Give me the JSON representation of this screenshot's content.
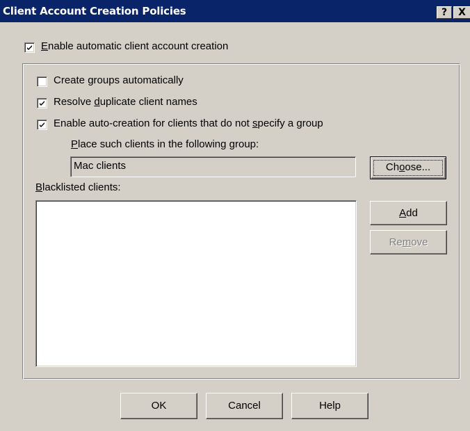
{
  "window": {
    "title": "Client Account Creation Policies",
    "help_button": "?",
    "close_button": "X"
  },
  "enable_auto": {
    "label_prefix": "",
    "label_ul": "E",
    "label_rest": "nable automatic client account creation",
    "checked": true
  },
  "options": {
    "create_groups": {
      "pre": "Create ",
      "ul": "g",
      "post": "roups automatically",
      "checked": false
    },
    "resolve_dup": {
      "pre": "Resolve ",
      "ul": "d",
      "post": "uplicate client names",
      "checked": true
    },
    "auto_no_group": {
      "pre": "Enable auto-creation for clients that do not ",
      "ul": "s",
      "post": "pecify a group",
      "checked": true
    }
  },
  "group_place": {
    "label_ul": "P",
    "label_rest": "lace such clients in the following group:",
    "value": "Mac clients",
    "choose_pre": "Ch",
    "choose_ul": "o",
    "choose_post": "ose..."
  },
  "blacklist": {
    "label_ul": "B",
    "label_rest": "lacklisted clients:",
    "items": [],
    "add_ul": "A",
    "add_rest": "dd",
    "remove_pre": "Re",
    "remove_ul": "m",
    "remove_post": "ove"
  },
  "footer": {
    "ok": "OK",
    "cancel": "Cancel",
    "help": "Help"
  },
  "colors": {
    "titlebar": "#0a246a",
    "face": "#d4d0c8"
  }
}
